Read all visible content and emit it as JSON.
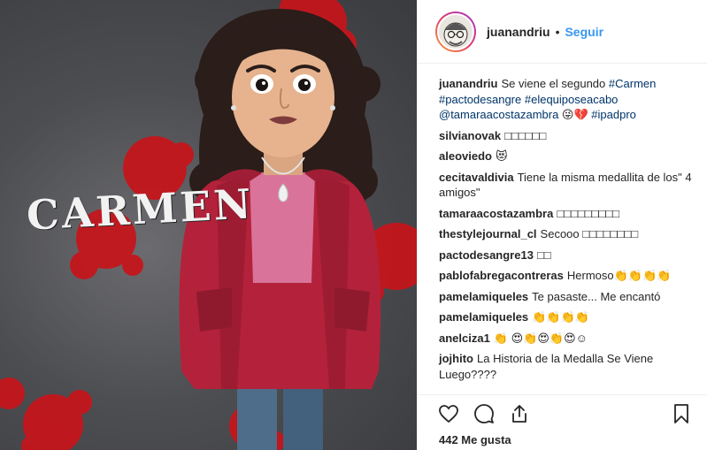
{
  "media": {
    "title_text": "CARMEN"
  },
  "header": {
    "username": "juanandriu",
    "dot": "•",
    "follow_label": "Seguir"
  },
  "caption": {
    "username": "juanandriu",
    "segments": [
      {
        "type": "text",
        "value": "Se viene el segundo "
      },
      {
        "type": "tag",
        "value": "#Carmen"
      },
      {
        "type": "text",
        "value": " "
      },
      {
        "type": "tag",
        "value": "#pactodesangre"
      },
      {
        "type": "text",
        "value": " "
      },
      {
        "type": "tag",
        "value": "#elequiposeacabo"
      },
      {
        "type": "text",
        "value": " "
      },
      {
        "type": "tag",
        "value": "@tamaraacostazambra"
      },
      {
        "type": "text",
        "value": " 😜💔 "
      },
      {
        "type": "tag",
        "value": "#ipadpro"
      }
    ]
  },
  "comments": [
    {
      "username": "silvianovak",
      "text": "□□□□□□"
    },
    {
      "username": "aleoviedo",
      "text": "😻"
    },
    {
      "username": "cecitavaldivia",
      "text": "Tiene la misma medallita de los\" 4 amigos\""
    },
    {
      "username": "tamaraacostazambra",
      "text": "□□□□□□□□□"
    },
    {
      "username": "thestylejournal_cl",
      "text": "Secooo □□□□□□□□"
    },
    {
      "username": "pactodesangre13",
      "text": "□□"
    },
    {
      "username": "pablofabregacontreras",
      "text": "Hermoso👏👏👏👏"
    },
    {
      "username": "pamelamiqueles",
      "text": "Te pasaste... Me encantó"
    },
    {
      "username": "pamelamiqueles",
      "text": "👏👏👏👏"
    },
    {
      "username": "anelciza1",
      "text": "👏 😍👏😍👏😍☺"
    },
    {
      "username": "jojhito",
      "text": "La Historia de la Medalla Se Viene Luego????"
    }
  ],
  "actions": {
    "like_icon": "heart-icon",
    "comment_icon": "comment-icon",
    "share_icon": "share-icon",
    "save_icon": "bookmark-icon"
  },
  "likes_text": "442 Me gusta",
  "colors": {
    "follow": "#3897f0",
    "tag": "#003569",
    "jacket": "#b3223a",
    "shirt": "#d9739a",
    "blood": "#c8141b"
  }
}
